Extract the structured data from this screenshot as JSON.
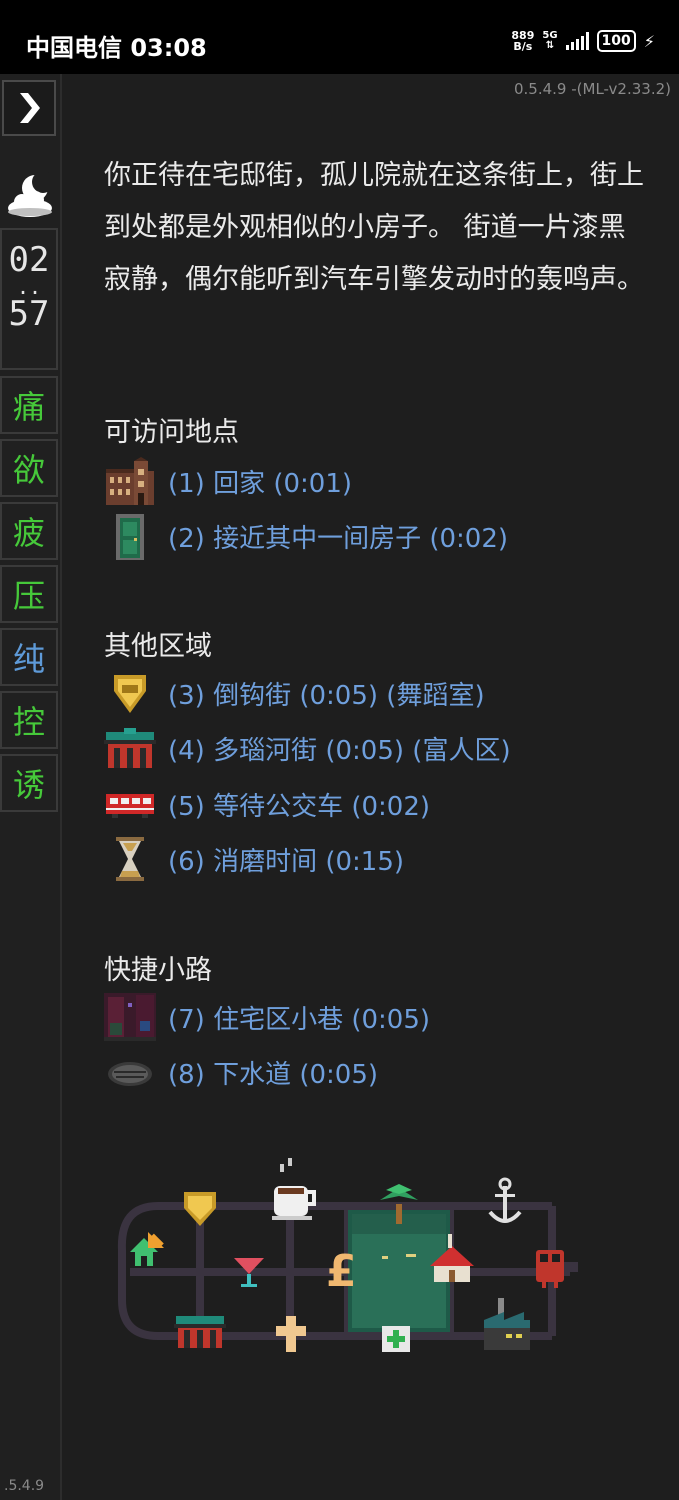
{
  "status_bar": {
    "carrier_time": "中国电信 03:08",
    "net_speed_top": "889",
    "net_speed_bottom": "B/s",
    "network": "5G",
    "battery": "100"
  },
  "sidebar": {
    "toggle_icon": "chevron-right-icon",
    "time_icon": "moon-cloud-icon",
    "clock_hour": "02",
    "clock_sep": "..",
    "clock_minute": "57",
    "stats": [
      {
        "label": "痛",
        "color": "#46c93a"
      },
      {
        "label": "欲",
        "color": "#46c93a"
      },
      {
        "label": "疲",
        "color": "#46c93a"
      },
      {
        "label": "压",
        "color": "#46c93a"
      },
      {
        "label": "纯",
        "color": "#5e9ad8"
      },
      {
        "label": "控",
        "color": "#46c93a"
      },
      {
        "label": "诱",
        "color": "#46c93a"
      }
    ],
    "version": ".5.4.9"
  },
  "version_label": "0.5.4.9 -(ML-v2.33.2)",
  "description": "你正待在宅邸街，孤儿院就在这条街上，街上到处都是外观相似的小房子。 街道一片漆黑寂静，偶尔能听到汽车引擎发动时的轰鸣声。",
  "sections": {
    "visitable": {
      "title": "可访问地点",
      "items": [
        {
          "label": "(1) 回家 (0:01)",
          "icon": "orphanage-building-icon"
        },
        {
          "label": "(2) 接近其中一间房子 (0:02)",
          "icon": "green-door-icon"
        }
      ]
    },
    "other_areas": {
      "title": "其他区域",
      "items": [
        {
          "label": "(3) 倒钩街 (0:05) (舞蹈室)",
          "icon": "gold-crest-icon"
        },
        {
          "label": "(4) 多瑙河街 (0:05) (富人区)",
          "icon": "mansion-gate-icon"
        },
        {
          "label": "(5) 等待公交车 (0:02)",
          "icon": "red-bus-icon"
        },
        {
          "label": "(6) 消磨时间 (0:15)",
          "icon": "hourglass-icon"
        }
      ]
    },
    "shortcuts": {
      "title": "快捷小路",
      "items": [
        {
          "label": "(7) 住宅区小巷 (0:05)",
          "icon": "alley-icon"
        },
        {
          "label": "(8) 下水道 (0:05)",
          "icon": "manhole-icon"
        }
      ]
    }
  },
  "map": {
    "icons": [
      "current-location-arrow-icon",
      "home-icon",
      "gold-crest-icon",
      "cocktail-icon",
      "coffee-cup-icon",
      "pound-sign-icon",
      "palm-tree-icon",
      "chapel-icon",
      "anchor-icon",
      "train-icon",
      "mansion-gate-icon",
      "holy-cross-icon",
      "hospital-icon",
      "factory-icon"
    ]
  }
}
